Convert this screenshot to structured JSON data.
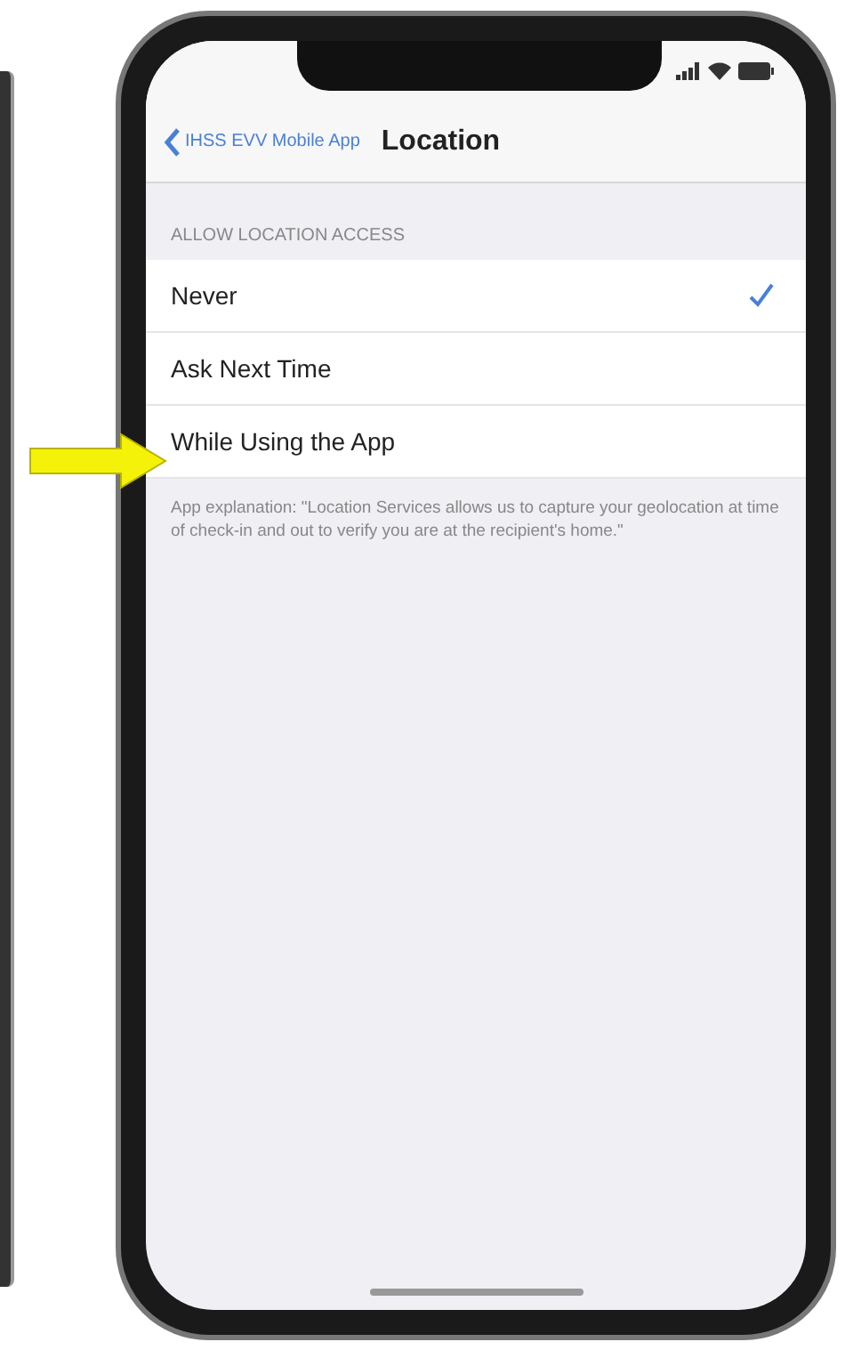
{
  "nav": {
    "back": "IHSS EVV Mobile App",
    "title": "Location"
  },
  "section_header": "ALLOW LOCATION ACCESS",
  "options": [
    {
      "label": "Never",
      "selected": true
    },
    {
      "label": "Ask Next Time",
      "selected": false
    },
    {
      "label": "While Using the App",
      "selected": false
    }
  ],
  "footer": "App explanation: \"Location Services allows us to capture your geolocation at time of check-in and out to verify you are at the recipient's home.\""
}
